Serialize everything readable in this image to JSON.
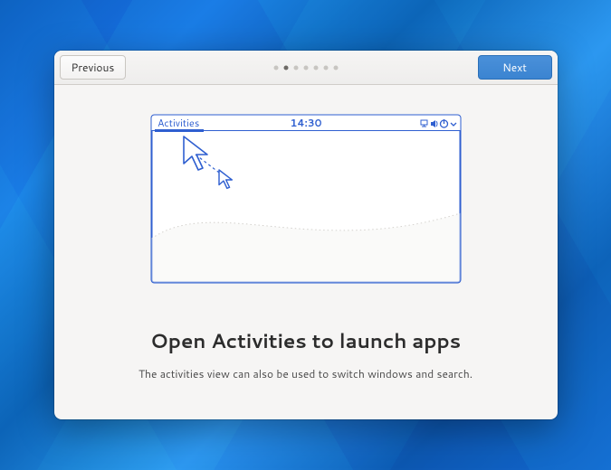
{
  "header": {
    "previous_label": "Previous",
    "next_label": "Next",
    "page_count": 7,
    "active_index": 1
  },
  "illustration": {
    "activities_label": "Activities",
    "time_label": "14:30",
    "icons": [
      "network-icon",
      "volume-icon",
      "power-icon",
      "dropdown-icon"
    ],
    "accent_color": "#2f5fd0"
  },
  "content": {
    "heading": "Open Activities to launch apps",
    "subtext": "The activities view can also be used to switch windows and search."
  }
}
